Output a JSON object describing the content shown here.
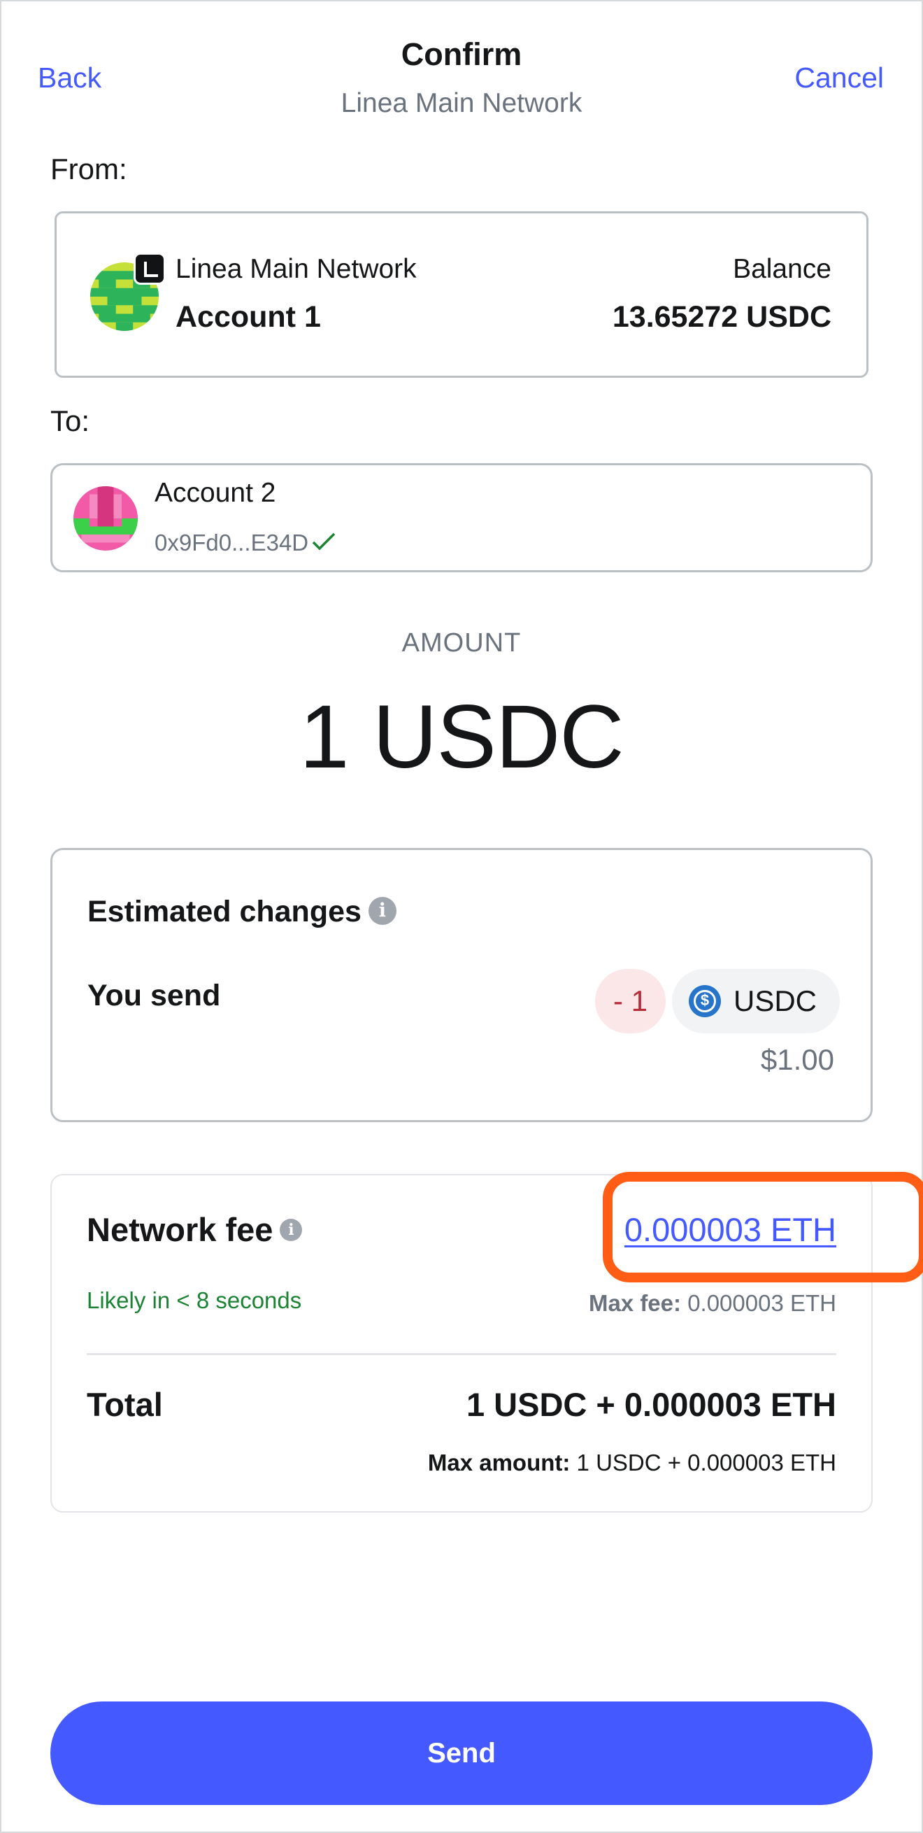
{
  "header": {
    "back_label": "Back",
    "title": "Confirm",
    "subtitle": "Linea Main Network",
    "cancel_label": "Cancel"
  },
  "from": {
    "section_label": "From:",
    "network": "Linea Main Network",
    "account": "Account 1",
    "balance_label": "Balance",
    "balance_value": "13.65272 USDC"
  },
  "to": {
    "section_label": "To:",
    "account": "Account 2",
    "address": "0x9Fd0...E34D"
  },
  "amount": {
    "label": "AMOUNT",
    "value": "1 USDC"
  },
  "estimated_changes": {
    "title": "Estimated changes",
    "you_send_label": "You send",
    "delta": "- 1",
    "token": "USDC",
    "fiat_value": "$1.00"
  },
  "fee": {
    "label": "Network fee",
    "value": "0.000003 ETH",
    "time_estimate": "Likely in < 8 seconds",
    "max_fee_label": "Max fee:",
    "max_fee_value": "0.000003 ETH",
    "total_label": "Total",
    "total_value": "1 USDC + 0.000003 ETH",
    "max_amount_label": "Max amount:",
    "max_amount_value": "1 USDC + 0.000003 ETH"
  },
  "send_label": "Send",
  "colors": {
    "accent": "#4459ff",
    "highlight": "#ff5c16",
    "success": "#1c8234",
    "error": "#b72d3a",
    "usdc": "#2775ca"
  }
}
